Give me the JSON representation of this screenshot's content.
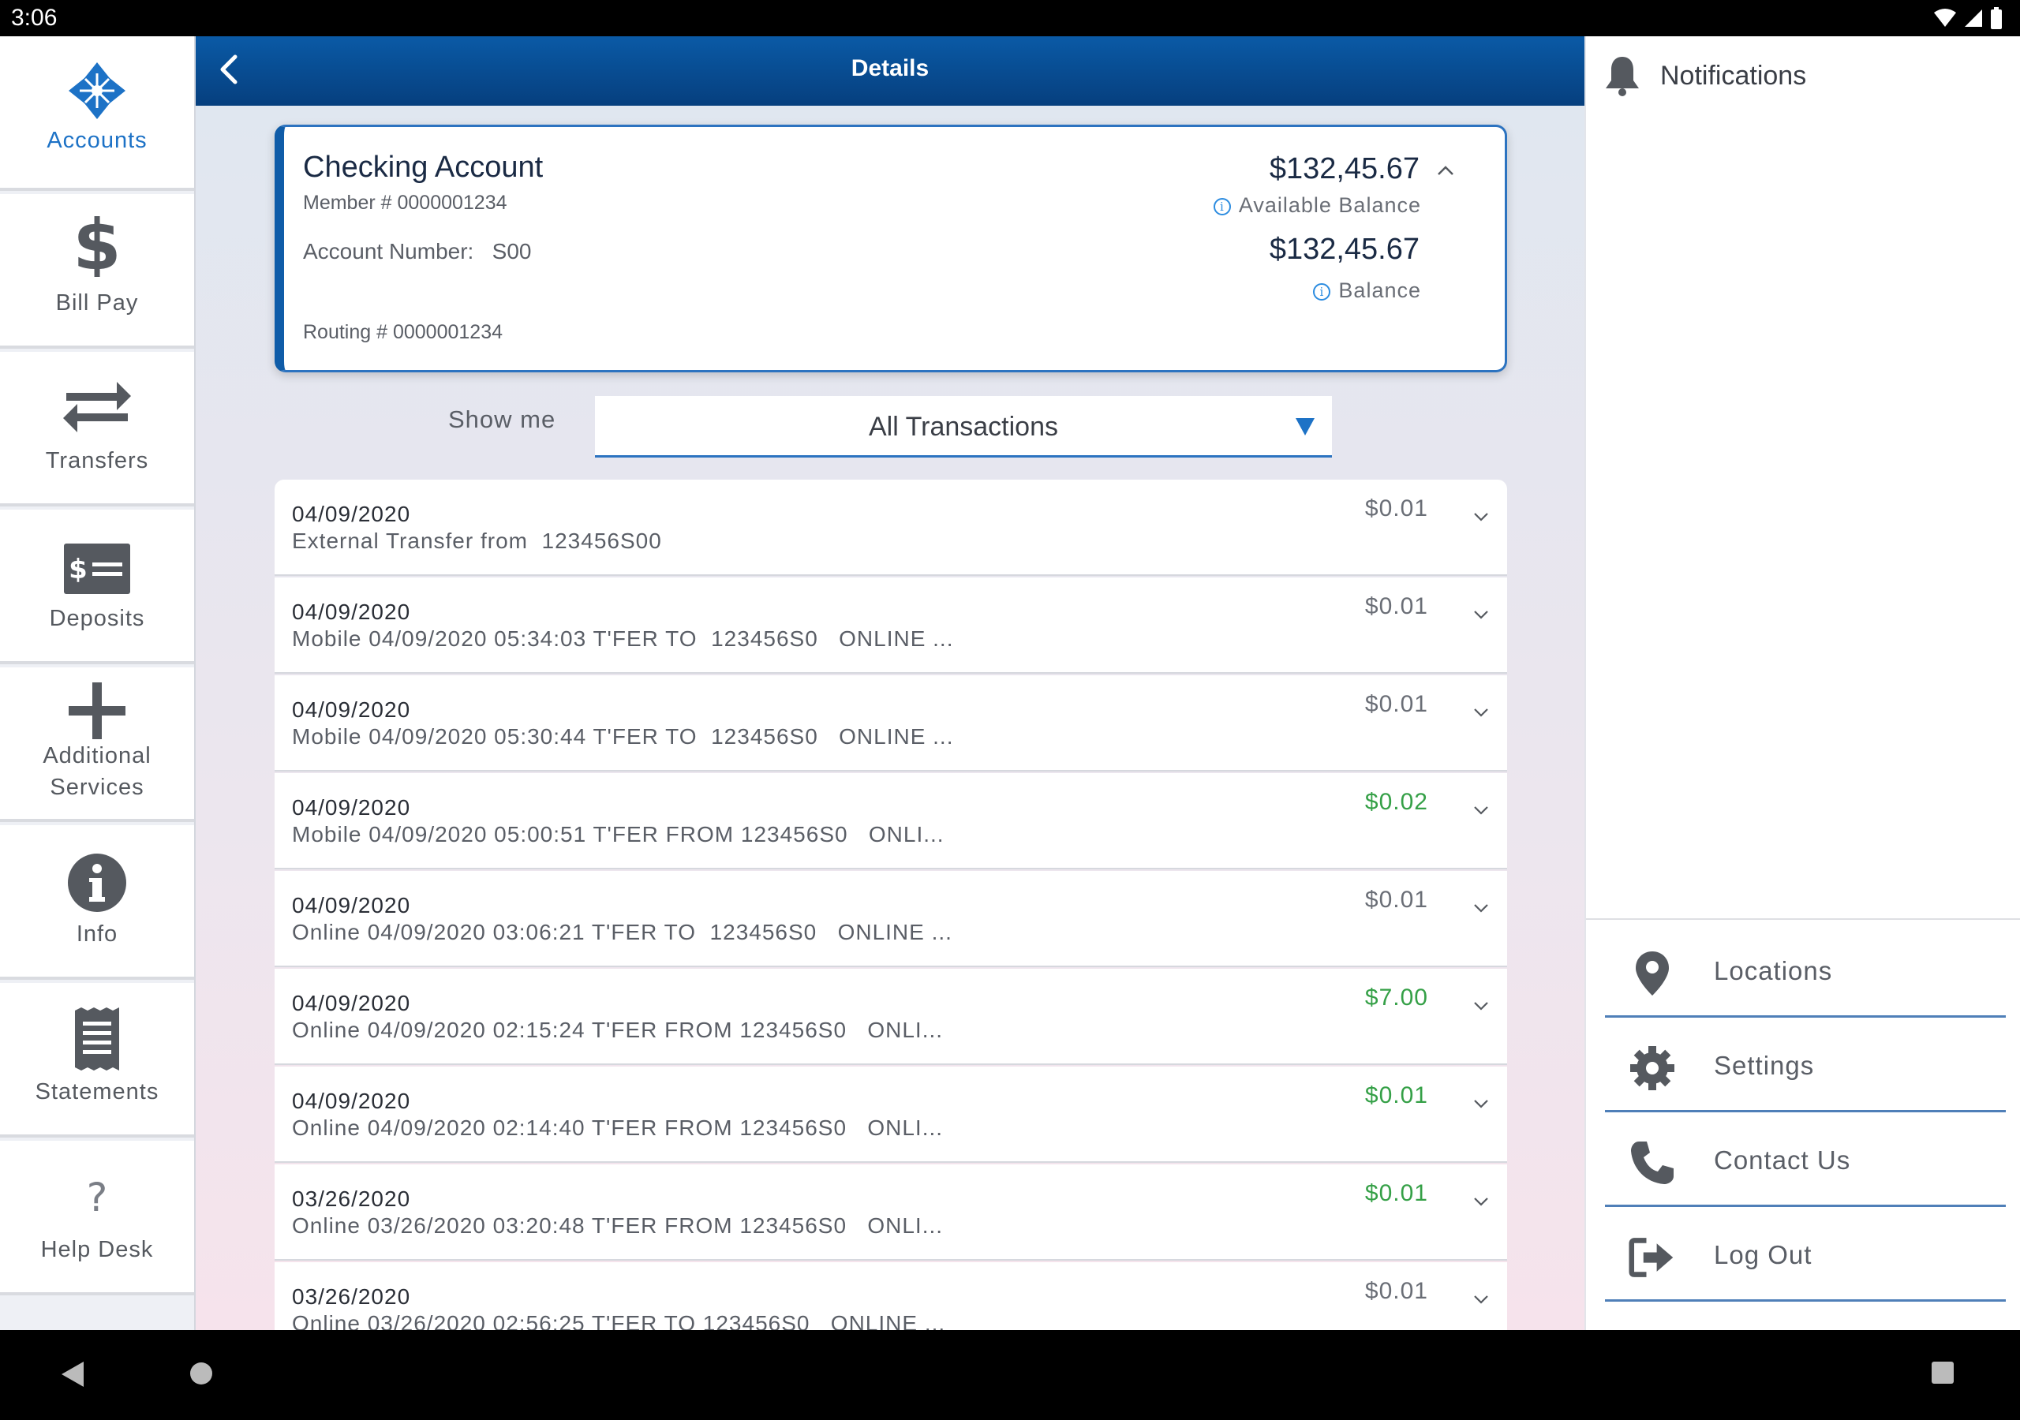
{
  "status_bar": {
    "time": "3:06"
  },
  "left_nav": {
    "items": [
      {
        "label": "Accounts",
        "icon": "accounts-icon",
        "active": true
      },
      {
        "label": "Bill Pay",
        "icon": "dollar-icon"
      },
      {
        "label": "Transfers",
        "icon": "transfer-arrows-icon"
      },
      {
        "label": "Deposits",
        "icon": "check-deposit-icon"
      },
      {
        "label": "Additional\nServices",
        "icon": "plus-icon"
      },
      {
        "label": "Info",
        "icon": "info-icon"
      },
      {
        "label": "Statements",
        "icon": "receipt-icon"
      },
      {
        "label": "Help Desk",
        "icon": "question-icon"
      }
    ]
  },
  "header": {
    "title": "Details"
  },
  "account": {
    "name": "Checking Account",
    "member": "Member # 0000001234",
    "account_number": "Account Number:   S00",
    "routing": "Routing # 0000001234",
    "available_balance": "$132,45.67",
    "available_balance_label": "Available Balance",
    "balance": "$132,45.67",
    "balance_label": "Balance"
  },
  "filter": {
    "label": "Show me",
    "selected": "All Transactions"
  },
  "transactions": [
    {
      "date": "04/09/2020",
      "desc": "External Transfer from  123456S00",
      "amount": "$0.01",
      "positive": false
    },
    {
      "date": "04/09/2020",
      "desc": "Mobile 04/09/2020 05:34:03 T'FER TO  123456S0   ONLINE ...",
      "amount": "$0.01",
      "positive": false
    },
    {
      "date": "04/09/2020",
      "desc": "Mobile 04/09/2020 05:30:44 T'FER TO  123456S0   ONLINE ...",
      "amount": "$0.01",
      "positive": false
    },
    {
      "date": "04/09/2020",
      "desc": "Mobile 04/09/2020 05:00:51 T'FER FROM 123456S0   ONLI...",
      "amount": "$0.02",
      "positive": true
    },
    {
      "date": "04/09/2020",
      "desc": "Online 04/09/2020 03:06:21 T'FER TO  123456S0   ONLINE ...",
      "amount": "$0.01",
      "positive": false
    },
    {
      "date": "04/09/2020",
      "desc": "Online 04/09/2020 02:15:24 T'FER FROM 123456S0   ONLI...",
      "amount": "$7.00",
      "positive": true
    },
    {
      "date": "04/09/2020",
      "desc": "Online 04/09/2020 02:14:40 T'FER FROM 123456S0   ONLI...",
      "amount": "$0.01",
      "positive": true
    },
    {
      "date": "03/26/2020",
      "desc": "Online 03/26/2020 03:20:48 T'FER FROM 123456S0   ONLI...",
      "amount": "$0.01",
      "positive": true
    },
    {
      "date": "03/26/2020",
      "desc": "Online 03/26/2020 02:56:25 T'FER TO 123456S0   ONLINE ...",
      "amount": "$0.01",
      "positive": false
    }
  ],
  "right_panel": {
    "notifications_label": "Notifications",
    "menu": [
      {
        "label": "Locations",
        "icon": "location-pin-icon"
      },
      {
        "label": "Settings",
        "icon": "gear-icon"
      },
      {
        "label": "Contact Us",
        "icon": "phone-icon"
      },
      {
        "label": "Log Out",
        "icon": "logout-icon"
      }
    ]
  },
  "colors": {
    "accent": "#1d72c6",
    "header": "#063f7e",
    "positive": "#35a047"
  }
}
